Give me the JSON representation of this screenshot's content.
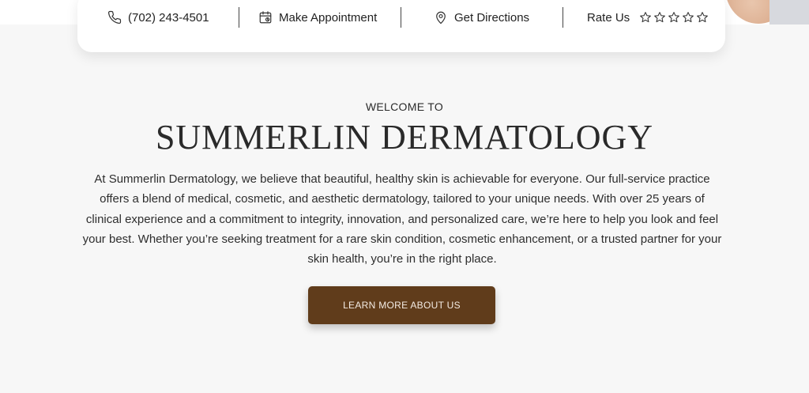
{
  "contact_bar": {
    "phone": {
      "icon": "phone-icon",
      "label": "(702) 243-4501"
    },
    "appointment": {
      "icon": "calendar-icon",
      "label": "Make Appointment"
    },
    "directions": {
      "icon": "map-pin-icon",
      "label": "Get Directions"
    },
    "rating": {
      "label": "Rate Us",
      "icon": "star-outline-icon",
      "stars_total": 5,
      "stars_filled": 0
    }
  },
  "intro": {
    "eyebrow": "WELCOME TO",
    "title": "SUMMERLIN DERMATOLOGY",
    "body": "At Summerlin Dermatology, we believe that beautiful, healthy skin is achievable for everyone. Our full-service practice offers a blend of medical, cosmetic, and aesthetic dermatology, tailored to your unique needs. With over 25 years of clinical experience and a commitment to integrity, innovation, and personalized care, we’re here to help you look and feel your best. Whether you’re seeking treatment for a rare skin condition, cosmetic enhancement, or a trusted partner for your skin health, you’re in the right place.",
    "cta_label": "LEARN MORE ABOUT US"
  },
  "colors": {
    "page_background": "#f7f7f7",
    "cta_background": "#603c1b",
    "cta_text": "#f3ebe3",
    "text": "#2b2b2b"
  }
}
